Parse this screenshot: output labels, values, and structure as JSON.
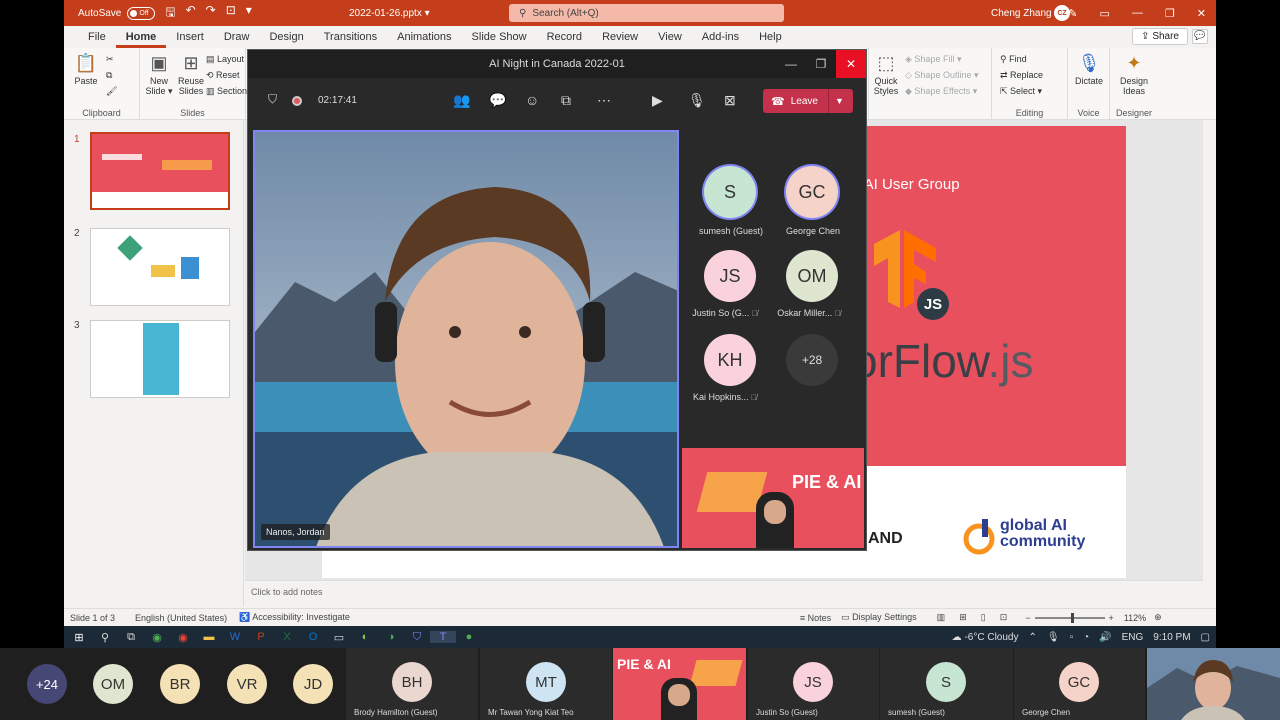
{
  "ppt": {
    "autosave_label": "AutoSave",
    "autosave_state": "Off",
    "doc_title": "2022-01-26.pptx ▾",
    "search_placeholder": "Search (Alt+Q)",
    "user_name": "Cheng Zhang",
    "user_initials": "CZ",
    "tabs": [
      "File",
      "Home",
      "Insert",
      "Draw",
      "Design",
      "Transitions",
      "Animations",
      "Slide Show",
      "Record",
      "Review",
      "View",
      "Add-ins",
      "Help"
    ],
    "share_label": "Share",
    "ribbon": {
      "paste": "Paste",
      "clipboard": "Clipboard",
      "new_slide": "New\nSlide ▾",
      "reuse_slides": "Reuse\nSlides",
      "layout": "Layout",
      "reset": "Reset",
      "section": "Section",
      "slides": "Slides",
      "quick_styles": "Quick\nStyles",
      "shape_fill": "Shape Fill ▾",
      "shape_outline": "Shape Outline ▾",
      "shape_effects": "Shape Effects ▾",
      "find": "Find",
      "replace": "Replace",
      "select": "Select ▾",
      "editing": "Editing",
      "dictate": "Dictate",
      "voice": "Voice",
      "design_ideas": "Design\nIdeas",
      "designer": "Designer"
    },
    "thumb_numbers": [
      "1",
      "2",
      "3"
    ],
    "slide": {
      "user_group": "g AI User Group",
      "tf_main": "orFlow",
      "tf_js": ".js",
      "js_badge": "JS",
      "and_text": "AND",
      "gai_line1": "global AI",
      "gai_line2": "community"
    },
    "notes_placeholder": "Click to add notes",
    "status": {
      "slide_of": "Slide 1 of 3",
      "language": "English (United States)",
      "accessibility": "Accessibility: Investigate",
      "notes": "Notes",
      "display_settings": "Display Settings",
      "zoom": "112%"
    }
  },
  "teams": {
    "title": "AI Night in Canada 2022-01",
    "timer": "02:17:41",
    "leave_label": "Leave",
    "main_speaker": "Nanos, Jordan",
    "participants": [
      {
        "initials": "S",
        "name": "sumesh (Guest)",
        "color": "#c7e5d3"
      },
      {
        "initials": "GC",
        "name": "George Chen",
        "color": "#f6d3c8"
      },
      {
        "initials": "JS",
        "name": "Justin So (G...",
        "color": "#f9d2dc"
      },
      {
        "initials": "OM",
        "name": "Oskar Miller...",
        "color": "#dfe6cf"
      },
      {
        "initials": "KH",
        "name": "Kai Hopkins...",
        "color": "#f9d2dc"
      }
    ],
    "more_count": "+28"
  },
  "taskbar": {
    "weather": "-6°C  Cloudy",
    "lang": "ENG",
    "time": "9:10 PM"
  },
  "gallery": {
    "more": "+24",
    "tiles": [
      {
        "initials": "OM",
        "color": "#dfe6cf"
      },
      {
        "initials": "BR",
        "color": "#f4e1b5"
      },
      {
        "initials": "VR",
        "color": "#f4e1b5"
      },
      {
        "initials": "JD",
        "color": "#f4e1b5"
      }
    ],
    "named": [
      {
        "initials": "BH",
        "name": "Brody Hamilton (Guest)",
        "color": "#ead7d0"
      },
      {
        "initials": "MT",
        "name": "Mr Tawan Yong Kiat Teo",
        "color": "#cfe4f3"
      },
      {
        "initials": "JS",
        "name": "Justin So (Guest)",
        "color": "#f9d2dc"
      },
      {
        "initials": "S",
        "name": "sumesh (Guest)",
        "color": "#c7e5d3"
      },
      {
        "initials": "GC",
        "name": "George Chen",
        "color": "#f6d3c8"
      }
    ],
    "share_title": "PIE & AI"
  }
}
